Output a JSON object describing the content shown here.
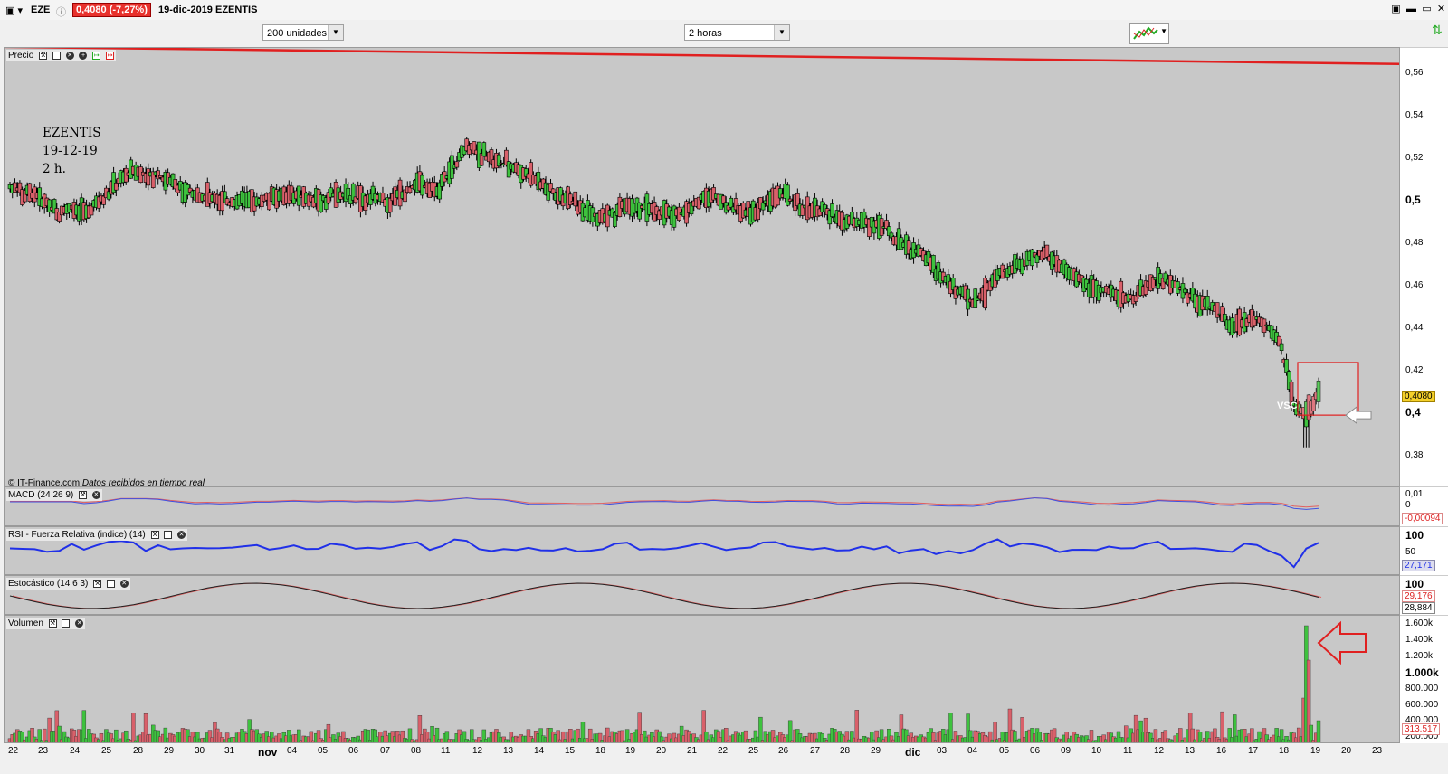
{
  "titlebar": {
    "symbol": "EZE",
    "price_badge": "0,4080 (-7,27%)",
    "date_name": "19-dic-2019 EZENTIS"
  },
  "toolbar": {
    "units_select": "200 unidades",
    "period_select": "2 horas"
  },
  "panes": {
    "price": {
      "header": "Precio",
      "annotation": [
        "EZENTIS",
        "19-12-19",
        "2 h."
      ],
      "vsc_label": "VSC",
      "copyright": "© IT-Finance.com",
      "realtime_note": "Datos recibidos en tiempo real",
      "axis": [
        "0,56",
        "0,54",
        "0,52",
        "0,5",
        "0,48",
        "0,46",
        "0,44",
        "0,42",
        "0,4",
        "0,38"
      ],
      "last_value": "0,4080"
    },
    "macd": {
      "header": "MACD (24 26 9)",
      "axis": [
        "0,01",
        "0"
      ],
      "last_value": "-0,00094"
    },
    "rsi": {
      "header": "RSI - Fuerza Relativa (indice) (14)",
      "axis": [
        "100",
        "50"
      ],
      "last_value": "27,171"
    },
    "stoch": {
      "header": "Estocástico (14 6 3)",
      "axis": [
        "100"
      ],
      "value_k": "29,176",
      "value_d": "28,884"
    },
    "volume": {
      "header": "Volumen",
      "axis": [
        "1.600k",
        "1.400k",
        "1.200k",
        "1.000k",
        "800.000",
        "600.000",
        "400.000",
        "200.000"
      ],
      "last_value": "313.517"
    }
  },
  "xaxis": [
    "22",
    "23",
    "24",
    "25",
    "28",
    "29",
    "30",
    "31",
    "nov",
    "04",
    "05",
    "06",
    "07",
    "08",
    "11",
    "12",
    "13",
    "14",
    "15",
    "18",
    "19",
    "20",
    "21",
    "22",
    "25",
    "26",
    "27",
    "28",
    "29",
    "dic",
    "03",
    "04",
    "05",
    "06",
    "09",
    "10",
    "11",
    "12",
    "13",
    "16",
    "17",
    "18",
    "19",
    "20",
    "23"
  ],
  "colors": {
    "up": "#3ec23e",
    "down": "#d9606a",
    "trendline": "#e02020",
    "macd": "#4050e0",
    "signal": "#e06060",
    "rsi": "#2030e8",
    "stoch_k": "#202020",
    "stoch_d": "#e06060",
    "badge": "#e8322d"
  },
  "chart_data": {
    "type": "candlestick",
    "timeframe": "2 horas",
    "y_range": [
      0.37,
      0.57
    ],
    "last_price": 0.408,
    "price_path": [
      0.505,
      0.503,
      0.502,
      0.498,
      0.492,
      0.496,
      0.493,
      0.497,
      0.503,
      0.509,
      0.513,
      0.51,
      0.511,
      0.507,
      0.505,
      0.502,
      0.501,
      0.499,
      0.497,
      0.499,
      0.5,
      0.499,
      0.5,
      0.501,
      0.5,
      0.499,
      0.501,
      0.502,
      0.5,
      0.501,
      0.499,
      0.5,
      0.503,
      0.507,
      0.504,
      0.506,
      0.515,
      0.524,
      0.521,
      0.518,
      0.516,
      0.514,
      0.511,
      0.507,
      0.503,
      0.5,
      0.496,
      0.493,
      0.491,
      0.493,
      0.497,
      0.496,
      0.494,
      0.493,
      0.492,
      0.495,
      0.5,
      0.502,
      0.497,
      0.495,
      0.493,
      0.497,
      0.501,
      0.5,
      0.497,
      0.495,
      0.495,
      0.49,
      0.488,
      0.49,
      0.487,
      0.486,
      0.479,
      0.476,
      0.474,
      0.466,
      0.462,
      0.456,
      0.451,
      0.456,
      0.465,
      0.467,
      0.47,
      0.473,
      0.474,
      0.468,
      0.465,
      0.462,
      0.457,
      0.456,
      0.455,
      0.454,
      0.458,
      0.464,
      0.46,
      0.457,
      0.454,
      0.45,
      0.446,
      0.44,
      0.443,
      0.444,
      0.44,
      0.43,
      0.404,
      0.401,
      0.408
    ],
    "volume_last": 313517
  }
}
